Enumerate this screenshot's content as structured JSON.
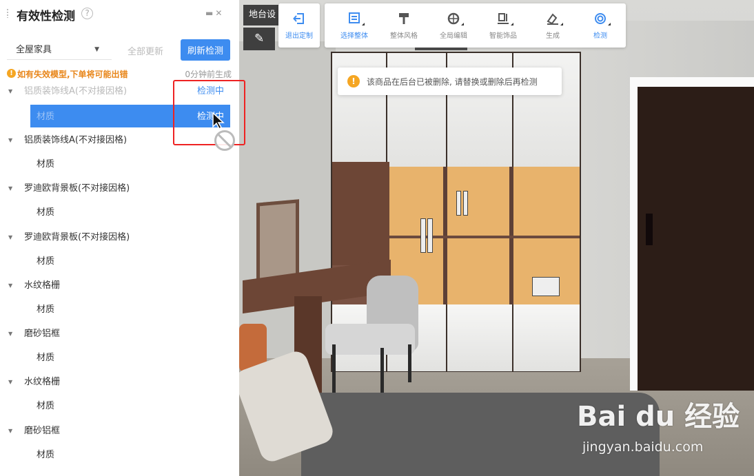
{
  "panel": {
    "title": "有效性检测",
    "help_symbol": "?",
    "scope_select": {
      "value": "全屋家具"
    },
    "update_all_label": "全部更新",
    "refresh_label": "刷新检测",
    "warning": {
      "text": "如有失效模型,下单将可能出错",
      "time": "0分钟前生成"
    },
    "items": [
      {
        "label": "铝质装饰线A(不对接因格)",
        "status": "检测中"
      },
      {
        "label": "材质",
        "status": "检测中"
      },
      {
        "label": "铝质装饰线A(不对接因格)"
      },
      {
        "label": "材质"
      },
      {
        "label": "罗迪欧背景板(不对接因格)"
      },
      {
        "label": "材质"
      },
      {
        "label": "罗迪欧背景板(不对接因格)"
      },
      {
        "label": "材质"
      },
      {
        "label": "水纹格栅"
      },
      {
        "label": "材质"
      },
      {
        "label": "磨砂铝框"
      },
      {
        "label": "材质"
      },
      {
        "label": "水纹格栅"
      },
      {
        "label": "材质"
      },
      {
        "label": "磨砂铝框"
      },
      {
        "label": "材质"
      }
    ]
  },
  "viewport": {
    "tag_label": "地台设",
    "exit_label": "退出定制",
    "tools": [
      {
        "label": "选择整体",
        "icon": "select-whole-icon"
      },
      {
        "label": "整体风格",
        "icon": "paint-roller-icon"
      },
      {
        "label": "全局编辑",
        "icon": "global-edit-icon"
      },
      {
        "label": "智能饰品",
        "icon": "smart-decor-icon"
      },
      {
        "label": "生成",
        "icon": "generate-icon"
      },
      {
        "label": "检测",
        "icon": "detect-icon"
      }
    ],
    "toast": {
      "text": "该商品在后台已被删除, 请替换或删除后再检测"
    },
    "accent_color": "#3d8cf0",
    "warning_color": "#f5a623"
  },
  "watermark": {
    "logo": "Bai du 经验",
    "url": "jingyan.baidu.com"
  }
}
